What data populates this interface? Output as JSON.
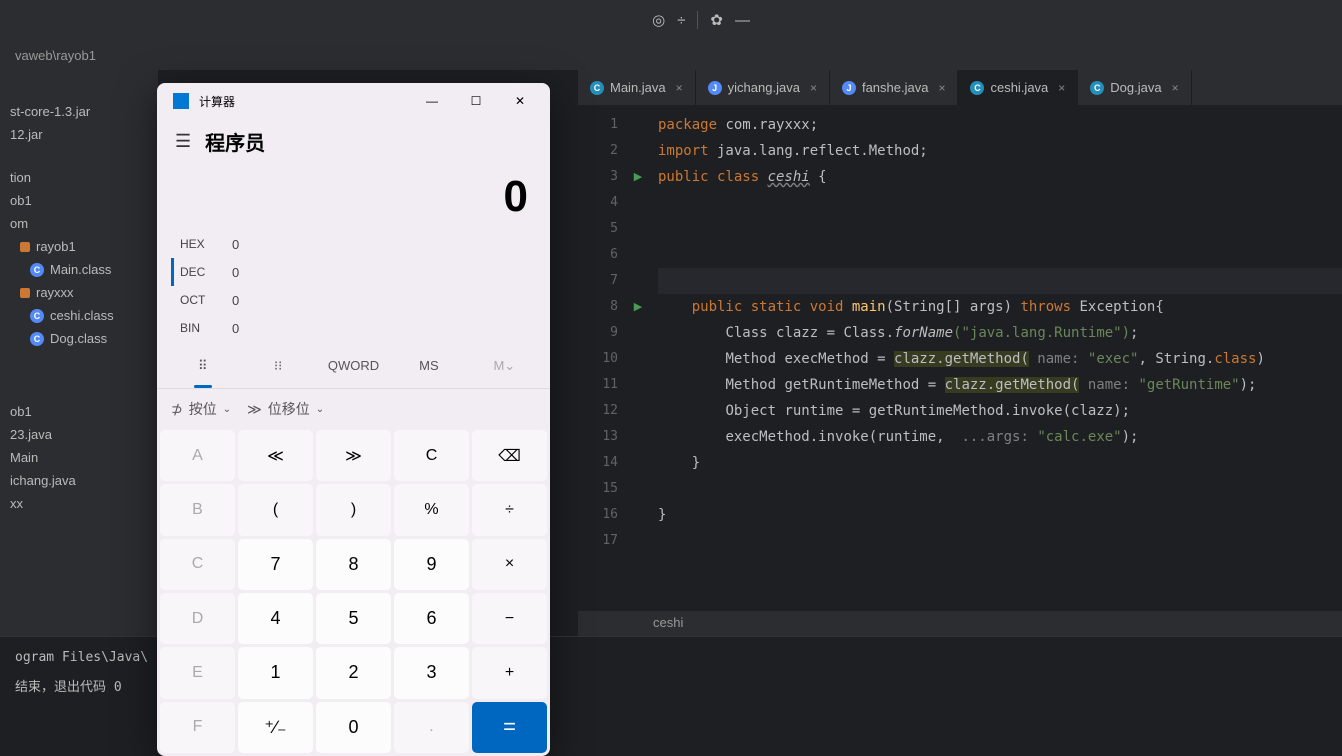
{
  "ide": {
    "breadcrumb": "vaweb\\rayob1",
    "sidebar": {
      "items": [
        {
          "label": "st-core-1.3.jar"
        },
        {
          "label": "12.jar"
        },
        {
          "label": "tion"
        },
        {
          "label": "ob1"
        },
        {
          "label": "om"
        },
        {
          "label": "rayob1",
          "orange": true
        },
        {
          "label": "Main.class",
          "cls": true
        },
        {
          "label": "rayxxx",
          "orange": true
        },
        {
          "label": "ceshi.class",
          "cls": true
        },
        {
          "label": "Dog.class",
          "cls": true
        },
        {
          "label": "ob1"
        },
        {
          "label": "23.java"
        },
        {
          "label": "Main"
        },
        {
          "label": "ichang.java"
        },
        {
          "label": "xx"
        }
      ]
    },
    "tabs": [
      {
        "label": "Main.java",
        "icon": "jv"
      },
      {
        "label": "yichang.java",
        "icon": "java"
      },
      {
        "label": "fanshe.java",
        "icon": "java"
      },
      {
        "label": "ceshi.java",
        "icon": "jv",
        "active": true
      },
      {
        "label": "Dog.java",
        "icon": "jv"
      }
    ],
    "code": {
      "lines": [
        "1",
        "2",
        "3",
        "4",
        "5",
        "6",
        "7",
        "8",
        "9",
        "10",
        "11",
        "12",
        "13",
        "14",
        "15",
        "16",
        "17"
      ],
      "l1_kw1": "package",
      "l1_txt": " com.rayxxx;",
      "l2_kw1": "import",
      "l2_txt": " java.lang.reflect.Method;",
      "l3_kw1": "public class ",
      "l3_cls": "ceshi",
      "l3_end": " {",
      "l8_kw": "public static void ",
      "l8_fn": "main",
      "l8_arg": "(String[] args) ",
      "l8_kw2": "throws ",
      "l8_exc": "Exception{",
      "l9_txt": "Class clazz = Class.",
      "l9_fn": "forName",
      "l9_str": "(\"java.lang.Runtime\")",
      "l9_end": ";",
      "l10_txt": "Method execMethod = ",
      "l10_hl": "clazz.getMethod(",
      "l10_param": " name: ",
      "l10_str": "\"exec\"",
      "l10_end": ", String.",
      "l10_cls": "class",
      "l10_end2": ")",
      "l11_txt": "Method getRuntimeMethod = ",
      "l11_hl": "clazz.getMethod(",
      "l11_param": " name: ",
      "l11_str": "\"getRuntime\"",
      "l11_end": ");",
      "l12_txt": "Object runtime = getRuntimeMethod.invoke(clazz);",
      "l13_txt": "execMethod.invoke(runtime, ",
      "l13_param": " ...args: ",
      "l13_str": "\"calc.exe\"",
      "l13_end": ");",
      "l14": "}",
      "l16": "}"
    },
    "breadcrumb_bottom": "ceshi",
    "console": {
      "line1": "ogram Files\\Java\\",
      "line2": "结束，退出代码 0"
    }
  },
  "calc": {
    "title": "计算器",
    "mode": "程序员",
    "display": "0",
    "radix": [
      {
        "label": "HEX",
        "value": "0"
      },
      {
        "label": "DEC",
        "value": "0",
        "active": true
      },
      {
        "label": "OCT",
        "value": "0"
      },
      {
        "label": "BIN",
        "value": "0"
      }
    ],
    "mode_tabs": {
      "qword": "QWORD",
      "ms": "MS",
      "mv": "M⌄"
    },
    "bit_ops": {
      "bitwise": "按位",
      "shift": "位移位"
    },
    "buttons": {
      "r1": [
        "A",
        "≪",
        "≫",
        "C",
        "⌫"
      ],
      "r2": [
        "B",
        "(",
        ")",
        "%",
        "÷"
      ],
      "r3": [
        "C",
        "7",
        "8",
        "9",
        "×"
      ],
      "r4": [
        "D",
        "4",
        "5",
        "6",
        "−"
      ],
      "r5": [
        "E",
        "1",
        "2",
        "3",
        "+"
      ],
      "r6": [
        "F",
        "⁺∕₋",
        "0",
        ".",
        "="
      ]
    }
  }
}
